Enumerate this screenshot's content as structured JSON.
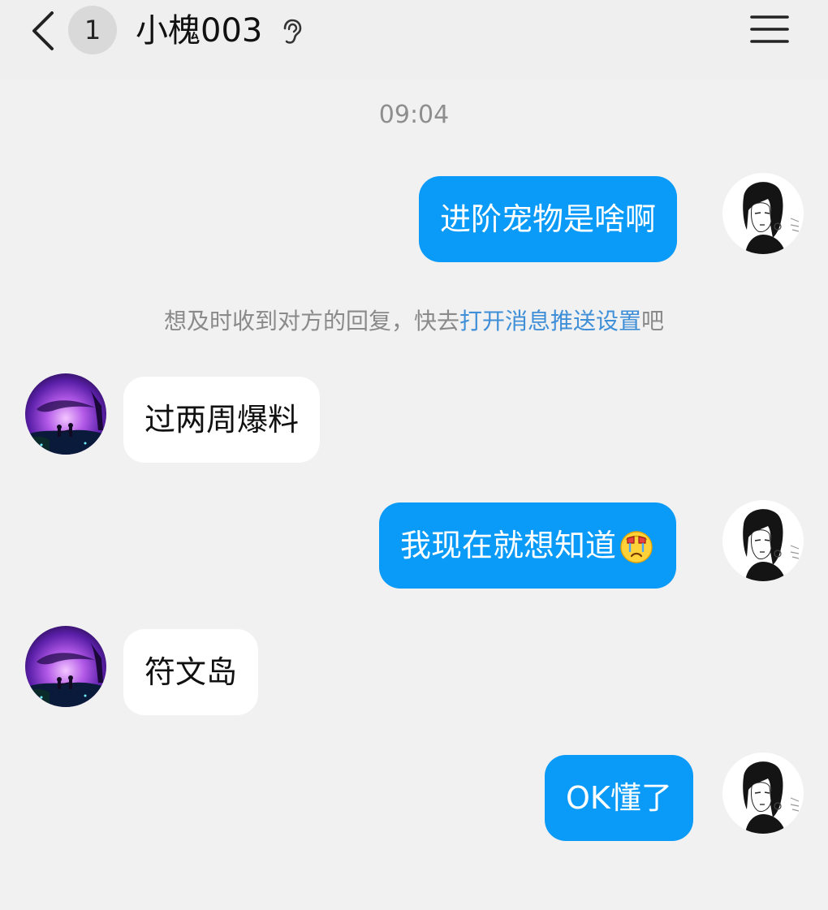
{
  "header": {
    "back_icon": "chevron-left-icon",
    "unread_count": "1",
    "contact_name": "小槐003",
    "ear_icon": "ear-icon",
    "menu_icon": "menu-icon"
  },
  "chat": {
    "timestamp": "09:04",
    "notice_prefix": "想及时收到对方的回复，快去",
    "notice_link": "打开消息推送设置",
    "notice_suffix": "吧",
    "messages": [
      {
        "direction": "out",
        "text": "进阶宠物是啥啊"
      },
      {
        "direction": "in",
        "text": "过两周爆料"
      },
      {
        "direction": "out",
        "text": "我现在就想知道",
        "emoji": "crying-face-emoji"
      },
      {
        "direction": "in",
        "text": "符文岛"
      },
      {
        "direction": "out",
        "text": "OK懂了"
      }
    ]
  },
  "colors": {
    "outgoing_bubble": "#0a9af7",
    "incoming_bubble": "#ffffff",
    "background": "#f1f1f1",
    "link": "#3f8fd8"
  }
}
